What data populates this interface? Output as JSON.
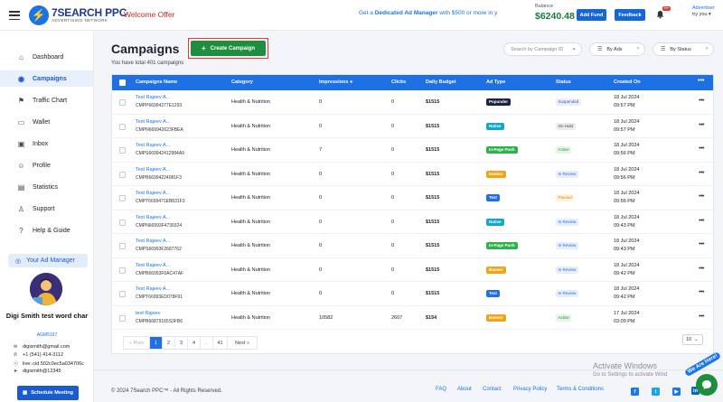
{
  "header": {
    "logo_title": "7SEARCH PPC",
    "logo_sub": "ADVERTISING NETWORK",
    "welcome": "Welcome Offer",
    "promo_prefix": "Get a ",
    "promo_bold": "Dedicated Ad Manager",
    "promo_suffix": " with $500 or more in y",
    "balance_label": "Balance",
    "balance_value": "$6240.48",
    "add_fund": "Add Fund",
    "feedback": "Feedback",
    "notif_badge": "99+",
    "user_role": "Advertiser",
    "user_name": "try you"
  },
  "sidebar": {
    "items": [
      {
        "label": "Dashboard",
        "icon": "home-icon"
      },
      {
        "label": "Campaigns",
        "icon": "campaigns-icon"
      },
      {
        "label": "Traffic Chart",
        "icon": "chart-icon"
      },
      {
        "label": "Wallet",
        "icon": "wallet-icon"
      },
      {
        "label": "Inbox",
        "icon": "inbox-icon"
      },
      {
        "label": "Profile",
        "icon": "profile-icon"
      },
      {
        "label": "Statistics",
        "icon": "statistics-icon"
      },
      {
        "label": "Support",
        "icon": "support-icon"
      },
      {
        "label": "Help & Guide",
        "icon": "help-icon"
      }
    ],
    "ad_manager_label": "Your Ad Manager",
    "manager_name": "Digi Smith test word char",
    "manager_id": "AGM5337",
    "contacts": [
      {
        "icon": "email-icon",
        "text": "digismith@gmail.com"
      },
      {
        "icon": "phone-icon",
        "text": "+1 (541) 414-3112"
      },
      {
        "icon": "skype-icon",
        "text": "live:.cid.502c0ec5a034706c"
      },
      {
        "icon": "telegram-icon",
        "text": "digismith@12345"
      }
    ],
    "schedule_label": "Schedule Meeting"
  },
  "main": {
    "title": "Campaigns",
    "subtitle": "You have total 401 campaigns",
    "create_label": "Create Campaign",
    "search_placeholder": "Search by Campaign ID",
    "filter_ads": "By Ads",
    "filter_status": "By Status",
    "columns": [
      "Campaigns Name",
      "Category",
      "Impressions",
      "Clicks",
      "Daily Budget",
      "Ad Type",
      "Status",
      "Created On"
    ],
    "rows": [
      {
        "name": "Test Rajeev A...",
        "code": "CMPP66994277E1293",
        "category": "Health & Nutrition",
        "impressions": "0",
        "clicks": "0",
        "budget": "$1515",
        "ad_type": "Popunder",
        "status": "Suspended",
        "date": "18 Jul 2024",
        "time": "09:57 PM"
      },
      {
        "name": "Test Rajeev A...",
        "code": "CMPN669942623FBEA",
        "category": "Health & Nutrition",
        "impressions": "0",
        "clicks": "0",
        "budget": "$1515",
        "ad_type": "Native",
        "status": "On Hold",
        "date": "18 Jul 2024",
        "time": "09:57 PM"
      },
      {
        "name": "Test Rajeev A...",
        "code": "CMPS669942412984A9",
        "category": "Health & Nutrition",
        "impressions": "7",
        "clicks": "0",
        "budget": "$1515",
        "ad_type": "In-Page Push",
        "status": "Active",
        "date": "18 Jul 2024",
        "time": "09:56 PM"
      },
      {
        "name": "Test Rajeev A...",
        "code": "CMPB66994224081F3",
        "category": "Health & Nutrition",
        "impressions": "0",
        "clicks": "0",
        "budget": "$1515",
        "ad_type": "Banner",
        "status": "In Review",
        "date": "18 Jul 2024",
        "time": "09:56 PM"
      },
      {
        "name": "Test Rajeev A...",
        "code": "CMPT66994?1EB831F3",
        "category": "Health & Nutrition",
        "impressions": "0",
        "clicks": "0",
        "budget": "$1515",
        "ad_type": "Text",
        "status": "Paused",
        "date": "18 Jul 2024",
        "time": "09:56 PM"
      },
      {
        "name": "Test Rajeev A...",
        "code": "CMPN66993F4730324",
        "category": "Health & Nutrition",
        "impressions": "0",
        "clicks": "0",
        "budget": "$1515",
        "ad_type": "Native",
        "status": "In Review",
        "date": "18 Jul 2024",
        "time": "09:43 PM"
      },
      {
        "name": "Test Rajeev A...",
        "code": "CMPS66993F2687762",
        "category": "Health & Nutrition",
        "impressions": "0",
        "clicks": "0",
        "budget": "$1515",
        "ad_type": "In-Page Push",
        "status": "In Review",
        "date": "18 Jul 2024",
        "time": "09:43 PM"
      },
      {
        "name": "Test Rajeev A...",
        "code": "CMPB66993F0AC47AF",
        "category": "Health & Nutrition",
        "impressions": "0",
        "clicks": "0",
        "budget": "$1515",
        "ad_type": "Banner",
        "status": "In Review",
        "date": "18 Jul 2024",
        "time": "09:42 PM"
      },
      {
        "name": "Test Rajeev A...",
        "code": "CMPT66993ED078F91",
        "category": "Health & Nutrition",
        "impressions": "0",
        "clicks": "0",
        "budget": "$1515",
        "ad_type": "Text",
        "status": "In Review",
        "date": "18 Jul 2024",
        "time": "09:42 PM"
      },
      {
        "name": "test Rajeev",
        "code": "CMPB66879165S3FB6",
        "category": "Health & Nutrition",
        "impressions": "10582",
        "clicks": "2607",
        "budget": "$154",
        "ad_type": "Banner",
        "status": "Active",
        "date": "17 Jul 2024",
        "time": "03:09 PM"
      }
    ],
    "pagination": [
      "« Prev",
      "1",
      "2",
      "3",
      "4",
      "...",
      "41",
      "Next »"
    ],
    "per_page": "10"
  },
  "footer": {
    "copyright": "© 2024 7Search PPC™ - All Rights Reserved.",
    "links": [
      "FAQ",
      "About",
      "Contact",
      "Privacy Policy",
      "Terms & Conditions"
    ]
  },
  "overlay": {
    "activate_title": "Activate Windows",
    "activate_sub": "Go to Settings to activate Wind",
    "here_badge": "We Are Here!"
  },
  "colors": {
    "primary": "#1f6fe5",
    "green": "#1e8e3e",
    "welcome_red": "#d02424"
  }
}
